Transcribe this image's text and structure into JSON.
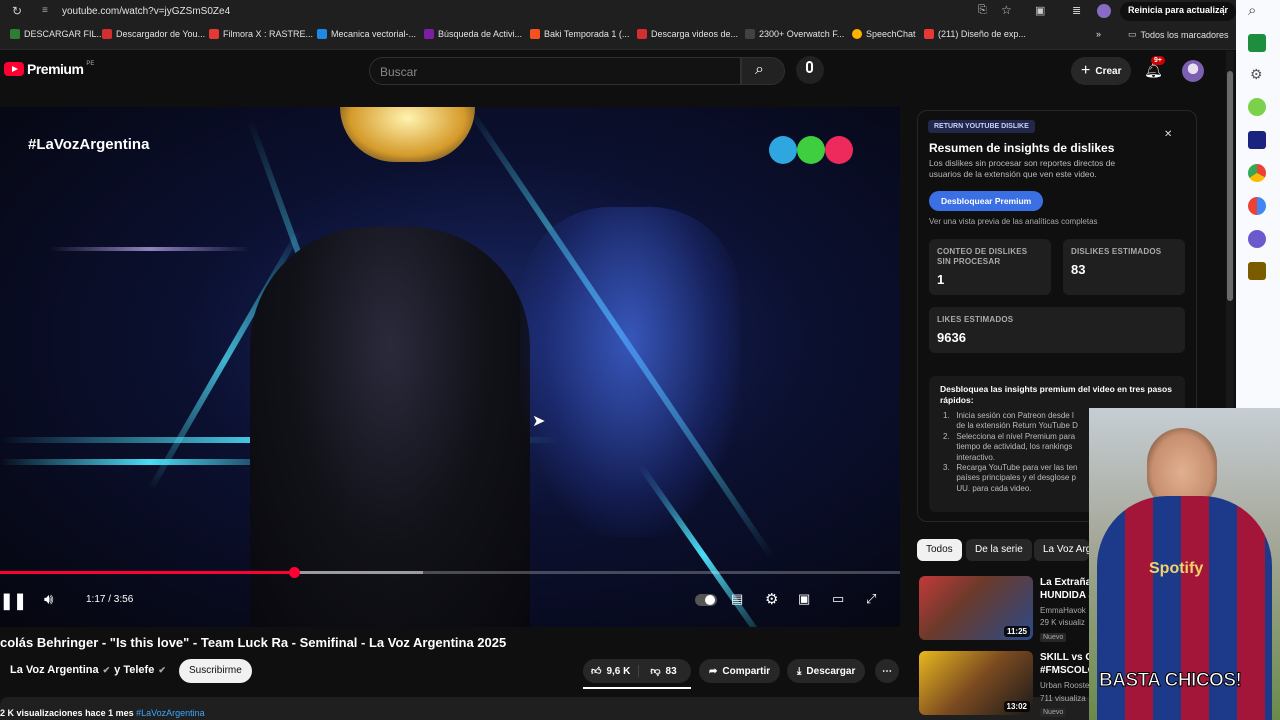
{
  "browser": {
    "url": "youtube.com/watch?v=jyGZSmS0Ze4",
    "restart_label": "Reinicia para actualizar",
    "bookmarks": [
      {
        "label": "DESCARGAR FIL...",
        "color": "#2e7d32"
      },
      {
        "label": "Descargador de You...",
        "color": "#d32f2f"
      },
      {
        "label": "Filmora X : RASTRE...",
        "color": "#e53935"
      },
      {
        "label": "Mecanica vectorial-...",
        "color": "#1e88e5"
      },
      {
        "label": "Búsqueda de Activi...",
        "color": "#7b1fa2"
      },
      {
        "label": "Baki Temporada 1 (...",
        "color": "#f4511e"
      },
      {
        "label": "Descarga videos de...",
        "color": "#d32f2f"
      },
      {
        "label": "2300+ Overwatch F...",
        "color": "#424242"
      },
      {
        "label": "SpeechChat",
        "color": "#ffb300"
      },
      {
        "label": "(211) Diseño de exp...",
        "color": "#e53935"
      }
    ],
    "all_bookmarks": "Todos los marcadores"
  },
  "youtube": {
    "logo_text": "Premium",
    "logo_region": "PE",
    "search_placeholder": "Buscar",
    "create_label": "Crear",
    "notif_count": "9+"
  },
  "video": {
    "hashtag_overlay": "#LaVozArgentina",
    "time": "1:17 / 3:56",
    "progress": 0.327,
    "buffered": 0.47,
    "title": "colás Behringer - \"Is this love\" - Team Luck Ra - Semifinal - La Voz Argentina 2025",
    "channel": "La Voz Argentina",
    "channel_and": "y Telefe",
    "subscribe": "Suscribirme",
    "likes": "9,6 K",
    "dislikes": "83",
    "share": "Compartir",
    "download": "Descargar",
    "views": "2 K visualizaciones",
    "date": "hace 1 mes",
    "tag": "#LaVozArgentina"
  },
  "rd_panel": {
    "badge": "RETURN YOUTUBE DISLIKE",
    "title": "Resumen de insights de dislikes",
    "desc": "Los dislikes sin procesar son reportes directos de usuarios de la extensión que ven este video.",
    "unlock_button": "Desbloquear Premium",
    "preview_text": "Ver una vista previa de las analíticas completas",
    "raw_label": "CONTEO DE DISLIKES SIN PROCESAR",
    "raw_value": "1",
    "est_dislikes_label": "DISLIKES ESTIMADOS",
    "est_dislikes_value": "83",
    "est_likes_label": "LIKES ESTIMADOS",
    "est_likes_value": "9636",
    "premium_title": "Desbloquea las insights premium del video en tres pasos rápidos:",
    "steps": [
      "Inicia sesión con Patreon desde l",
      "de la extensión Return YouTube D",
      "Selecciona el nivel Premium para",
      "tiempo de actividad, los rankings",
      "interactivo.",
      "Recarga YouTube para ver las ten",
      "países principales y el desglose p",
      "UU. para cada video."
    ]
  },
  "chips": [
    "Todos",
    "De la serie",
    "La Voz Arg"
  ],
  "recommendations": [
    {
      "title1": "La Extraña",
      "title2": "HUNDIDA a",
      "channel": "EmmaHavok",
      "meta": "29 K visualiz",
      "badge": "Nuevo",
      "duration": "11:25"
    },
    {
      "title1": "SKILL vs GA",
      "title2": "#FMSCOLO",
      "channel": "Urban Rooste",
      "meta": "711 visualiza",
      "badge": "Nuevo",
      "duration": "13:02"
    }
  ],
  "webcam": {
    "caption": "BASTA CHICOS!",
    "shirt_brand": "Spotify"
  }
}
